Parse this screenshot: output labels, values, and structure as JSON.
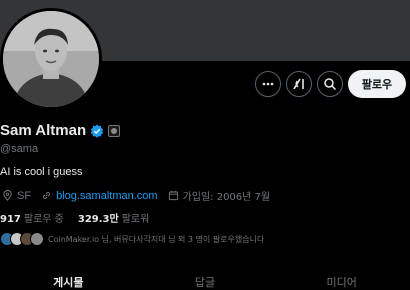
{
  "profile": {
    "display_name": "Sam Altman",
    "handle": "@sama",
    "bio": "AI is cool i guess",
    "location": "SF",
    "website": "blog.samaltman.com",
    "joined": "가입일: 2006년 7월"
  },
  "actions": {
    "follow_label": "팔로우"
  },
  "stats": {
    "following_count": "917",
    "following_label": "팔로우 중",
    "followers_count": "329.3만",
    "followers_label": "팔로워"
  },
  "followed_by": {
    "text": "CoinMaker.io 님, 버뮤다사각지대 님 외 3 명이 팔로우했습니다"
  },
  "tabs": [
    {
      "label": "게시물",
      "active": true
    },
    {
      "label": "답글",
      "active": false
    },
    {
      "label": "미디어",
      "active": false
    }
  ],
  "colors": {
    "background": "#000000",
    "banner": "#333639",
    "accent": "#1d9bf0",
    "text_primary": "#e7e9ea",
    "text_secondary": "#71767b"
  },
  "icons": {
    "more": "more-horizontal-icon",
    "grok": "grok-icon",
    "search": "search-icon",
    "verified": "verified-badge-icon",
    "location": "location-pin-icon",
    "link": "link-icon",
    "calendar": "calendar-icon"
  }
}
